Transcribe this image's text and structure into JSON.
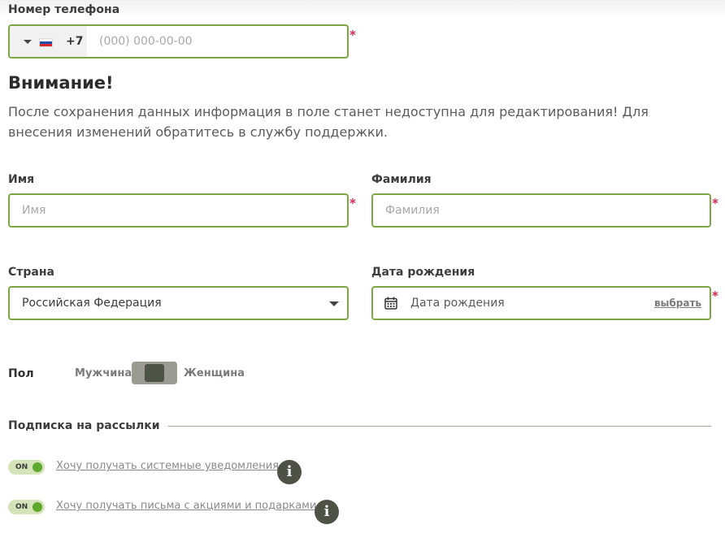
{
  "phone": {
    "label": "Номер телефона",
    "code": "+7",
    "placeholder": "(000) 000-00-00",
    "country_flag": "russia-flag-icon",
    "required_mark": "*"
  },
  "warning": {
    "title": "Внимание!",
    "text": "После сохранения данных информация в поле станет недоступна для редактирования! Для внесения изменений обратитесь в службу поддержки."
  },
  "first_name": {
    "label": "Имя",
    "placeholder": "Имя",
    "required_mark": "*"
  },
  "last_name": {
    "label": "Фамилия",
    "placeholder": "Фамилия",
    "required_mark": "*"
  },
  "country": {
    "label": "Страна",
    "value": "Российская Федерация"
  },
  "birth_date": {
    "label": "Дата рождения",
    "placeholder": "Дата рождения",
    "pick_label": "выбрать",
    "required_mark": "*"
  },
  "gender": {
    "label": "Пол",
    "male": "Мужчина",
    "female": "Женщина"
  },
  "subscriptions": {
    "title": "Подписка на рассылки",
    "items": [
      {
        "toggle": "ON",
        "label": "Хочу получать системные уведомления"
      },
      {
        "toggle": "ON",
        "label": "Хочу получать письма с акциями и подарками"
      }
    ]
  },
  "colors": {
    "accent_border": "#7fa644",
    "required": "#d6284f",
    "toggle_on": "#5fa82e",
    "info_icon": "#4c5244"
  }
}
